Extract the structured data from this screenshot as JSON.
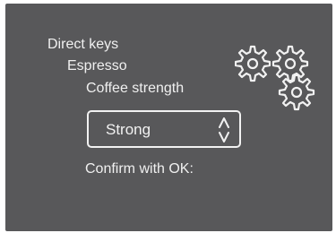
{
  "menu": {
    "breadcrumb": [
      "Direct keys",
      "Espresso",
      "Coffee strength"
    ]
  },
  "setting": {
    "selected_value": "Strong"
  },
  "prompt": {
    "confirm_text": "Confirm with OK:"
  },
  "icons": {
    "settings": "gears-icon",
    "selector": "up-down-arrows-icon"
  },
  "colors": {
    "screen_background": "#58585a",
    "foreground": "#f2f2f2"
  }
}
